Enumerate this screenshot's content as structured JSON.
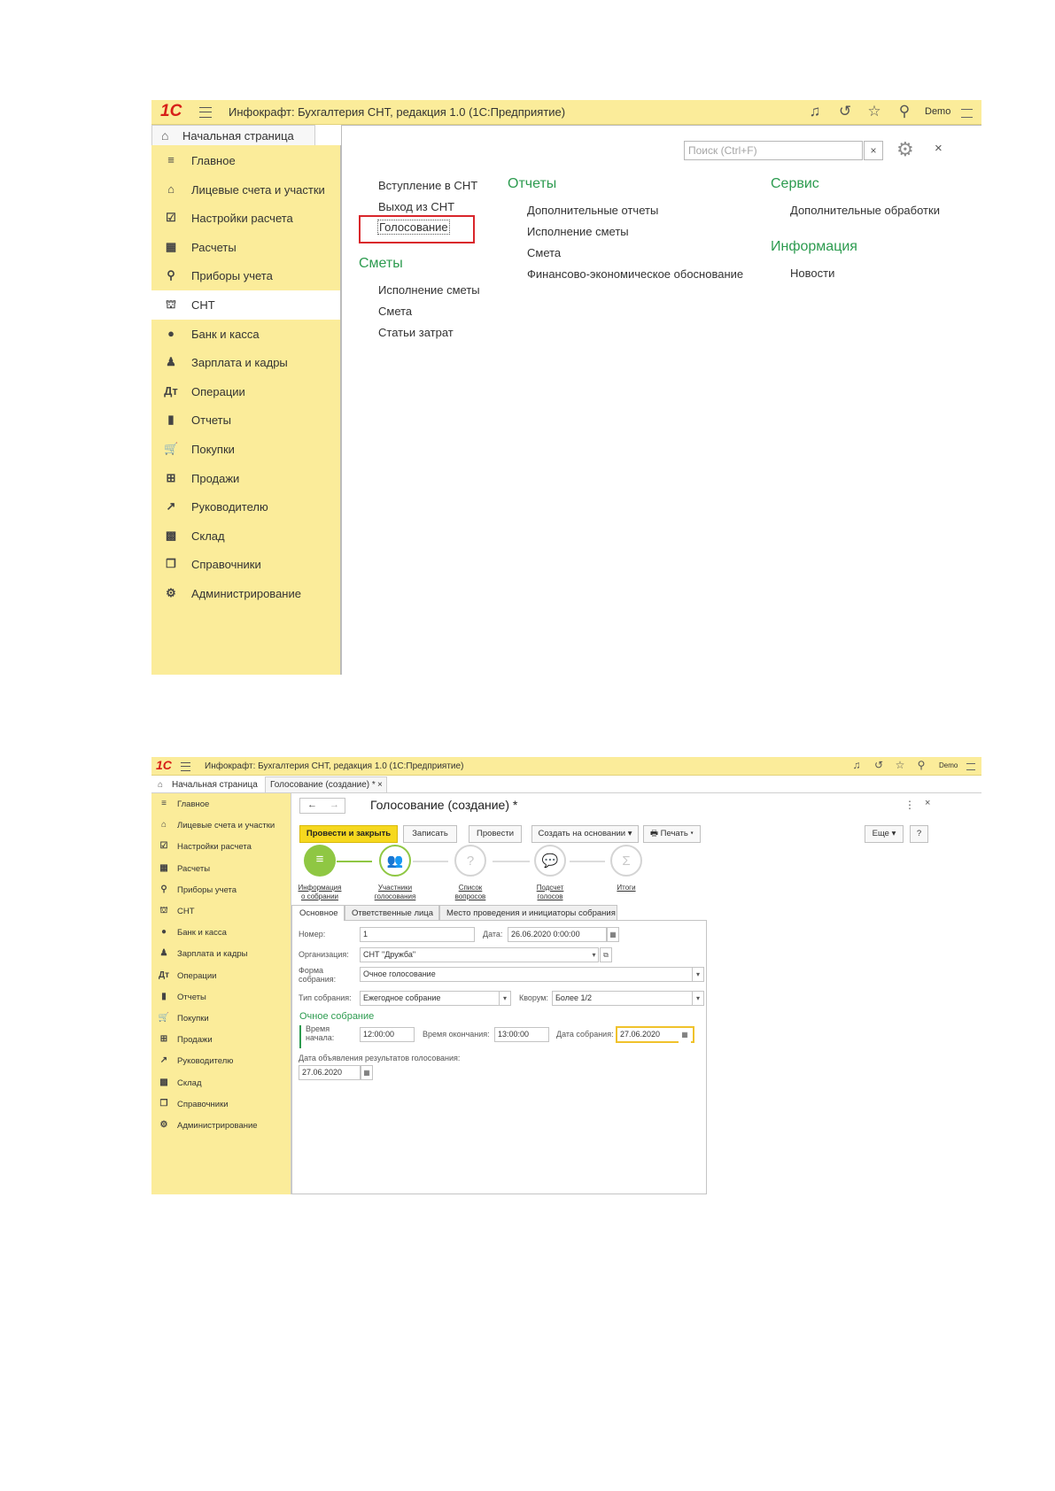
{
  "app": {
    "logo": "1С",
    "title": "Инфокрафт: Бухгалтерия СНТ, редакция 1.0  (1С:Предприятие)",
    "user": "Demo",
    "icons": [
      "bell-icon",
      "history-icon",
      "star-icon",
      "search-icon",
      "menu-icon"
    ]
  },
  "screen1": {
    "home_tab": "Начальная страница",
    "search": {
      "placeholder": "Поиск (Ctrl+F)",
      "clear": "×"
    },
    "close": "×",
    "sidebar": [
      {
        "label": "Главное",
        "icon": "≡",
        "icon_name": "main-menu-icon"
      },
      {
        "label": "Лицевые счета и участки",
        "icon": "⌂",
        "icon_name": "house-icon"
      },
      {
        "label": "Настройки расчета",
        "icon": "☑",
        "icon_name": "checkbox-icon"
      },
      {
        "label": "Расчеты",
        "icon": "▦",
        "icon_name": "calculator-icon"
      },
      {
        "label": "Приборы учета",
        "icon": "⚲",
        "icon_name": "meter-icon"
      },
      {
        "label": "СНТ",
        "icon": "⛫",
        "icon_name": "structure-icon"
      },
      {
        "label": "Банк и касса",
        "icon": "●",
        "icon_name": "bank-icon"
      },
      {
        "label": "Зарплата и кадры",
        "icon": "♟",
        "icon_name": "person-icon"
      },
      {
        "label": "Операции",
        "icon": "Дт",
        "icon_name": "operations-icon"
      },
      {
        "label": "Отчеты",
        "icon": "▮",
        "icon_name": "bar-chart-icon"
      },
      {
        "label": "Покупки",
        "icon": "🛒",
        "icon_name": "cart-icon"
      },
      {
        "label": "Продажи",
        "icon": "⊞",
        "icon_name": "bag-icon"
      },
      {
        "label": "Руководителю",
        "icon": "↗",
        "icon_name": "trend-icon"
      },
      {
        "label": "Склад",
        "icon": "▩",
        "icon_name": "warehouse-icon"
      },
      {
        "label": "Справочники",
        "icon": "❐",
        "icon_name": "books-icon"
      },
      {
        "label": "Администрирование",
        "icon": "⚙",
        "icon_name": "gear-icon"
      }
    ],
    "col1": {
      "items_top": [
        "Вступление в СНТ",
        "Выход из СНТ",
        "Голосование"
      ],
      "smety_header": "Сметы",
      "smety_items": [
        "Исполнение сметы",
        "Смета",
        "Статьи затрат"
      ]
    },
    "col2": {
      "header": "Отчеты",
      "items": [
        "Дополнительные отчеты",
        "Исполнение сметы",
        "Смета",
        "Финансово-экономическое обоснование"
      ]
    },
    "col3": {
      "service_header": "Сервис",
      "service_items": [
        "Дополнительные обработки"
      ],
      "info_header": "Информация",
      "info_items": [
        "Новости"
      ]
    }
  },
  "screen2": {
    "tabs": [
      "Начальная страница",
      "Голосование (создание) *"
    ],
    "tab_close": "×",
    "sidebar": [
      {
        "label": "Главное",
        "icon": "≡"
      },
      {
        "label": "Лицевые счета и участки",
        "icon": "⌂"
      },
      {
        "label": "Настройки расчета",
        "icon": "☑"
      },
      {
        "label": "Расчеты",
        "icon": "▦"
      },
      {
        "label": "Приборы учета",
        "icon": "⚲"
      },
      {
        "label": "СНТ",
        "icon": "⛫"
      },
      {
        "label": "Банк и касса",
        "icon": "●"
      },
      {
        "label": "Зарплата и кадры",
        "icon": "♟"
      },
      {
        "label": "Операции",
        "icon": "Дт"
      },
      {
        "label": "Отчеты",
        "icon": "▮"
      },
      {
        "label": "Покупки",
        "icon": "🛒"
      },
      {
        "label": "Продажи",
        "icon": "⊞"
      },
      {
        "label": "Руководителю",
        "icon": "↗"
      },
      {
        "label": "Склад",
        "icon": "▩"
      },
      {
        "label": "Справочники",
        "icon": "❐"
      },
      {
        "label": "Администрирование",
        "icon": "⚙"
      }
    ],
    "form_title": "Голосование (создание) *",
    "more": "⋮",
    "close": "×",
    "toolbar": {
      "post_close": "Провести и закрыть",
      "save": "Записать",
      "post": "Провести",
      "create_based": "Создать на основании ▾",
      "print": "🖶 Печать ▾",
      "more": "Еще ▾",
      "help": "?"
    },
    "steps": [
      {
        "label_line1": "Информация",
        "label_line2": "о собрании",
        "icon": "≡",
        "state": "done"
      },
      {
        "label_line1": "Участники",
        "label_line2": "голосования",
        "icon": "👥",
        "state": "current"
      },
      {
        "label_line1": "Список",
        "label_line2": "вопросов",
        "icon": "?",
        "state": "todo"
      },
      {
        "label_line1": "Подсчет",
        "label_line2": "голосов",
        "icon": "💬",
        "state": "todo"
      },
      {
        "label_line1": "Итоги",
        "label_line2": "",
        "icon": "Σ",
        "state": "todo"
      }
    ],
    "form_tabs": [
      "Основное",
      "Ответственные лица",
      "Место проведения и инициаторы собрания"
    ],
    "fields": {
      "number_label": "Номер:",
      "number": "1",
      "date_label": "Дата:",
      "date": "26.06.2020  0:00:00",
      "org_label": "Организация:",
      "org": "СНТ \"Дружба\"",
      "form_label_1": "Форма",
      "form_label_2": "собрания:",
      "form": "Очное голосование",
      "type_label": "Тип собрания:",
      "type": "Ежегодное собрание",
      "quorum_label": "Кворум:",
      "quorum": "Более 1/2",
      "group": "Очное собрание",
      "start_label_1": "Время",
      "start_label_2": "начала:",
      "start": "12:00:00",
      "end_label": "Время окончания:",
      "end": "13:00:00",
      "meeting_date_label": "Дата собрания:",
      "meeting_date": "27.06.2020",
      "results_label": "Дата объявления результатов голосования:",
      "results_date": "27.06.2020"
    }
  }
}
